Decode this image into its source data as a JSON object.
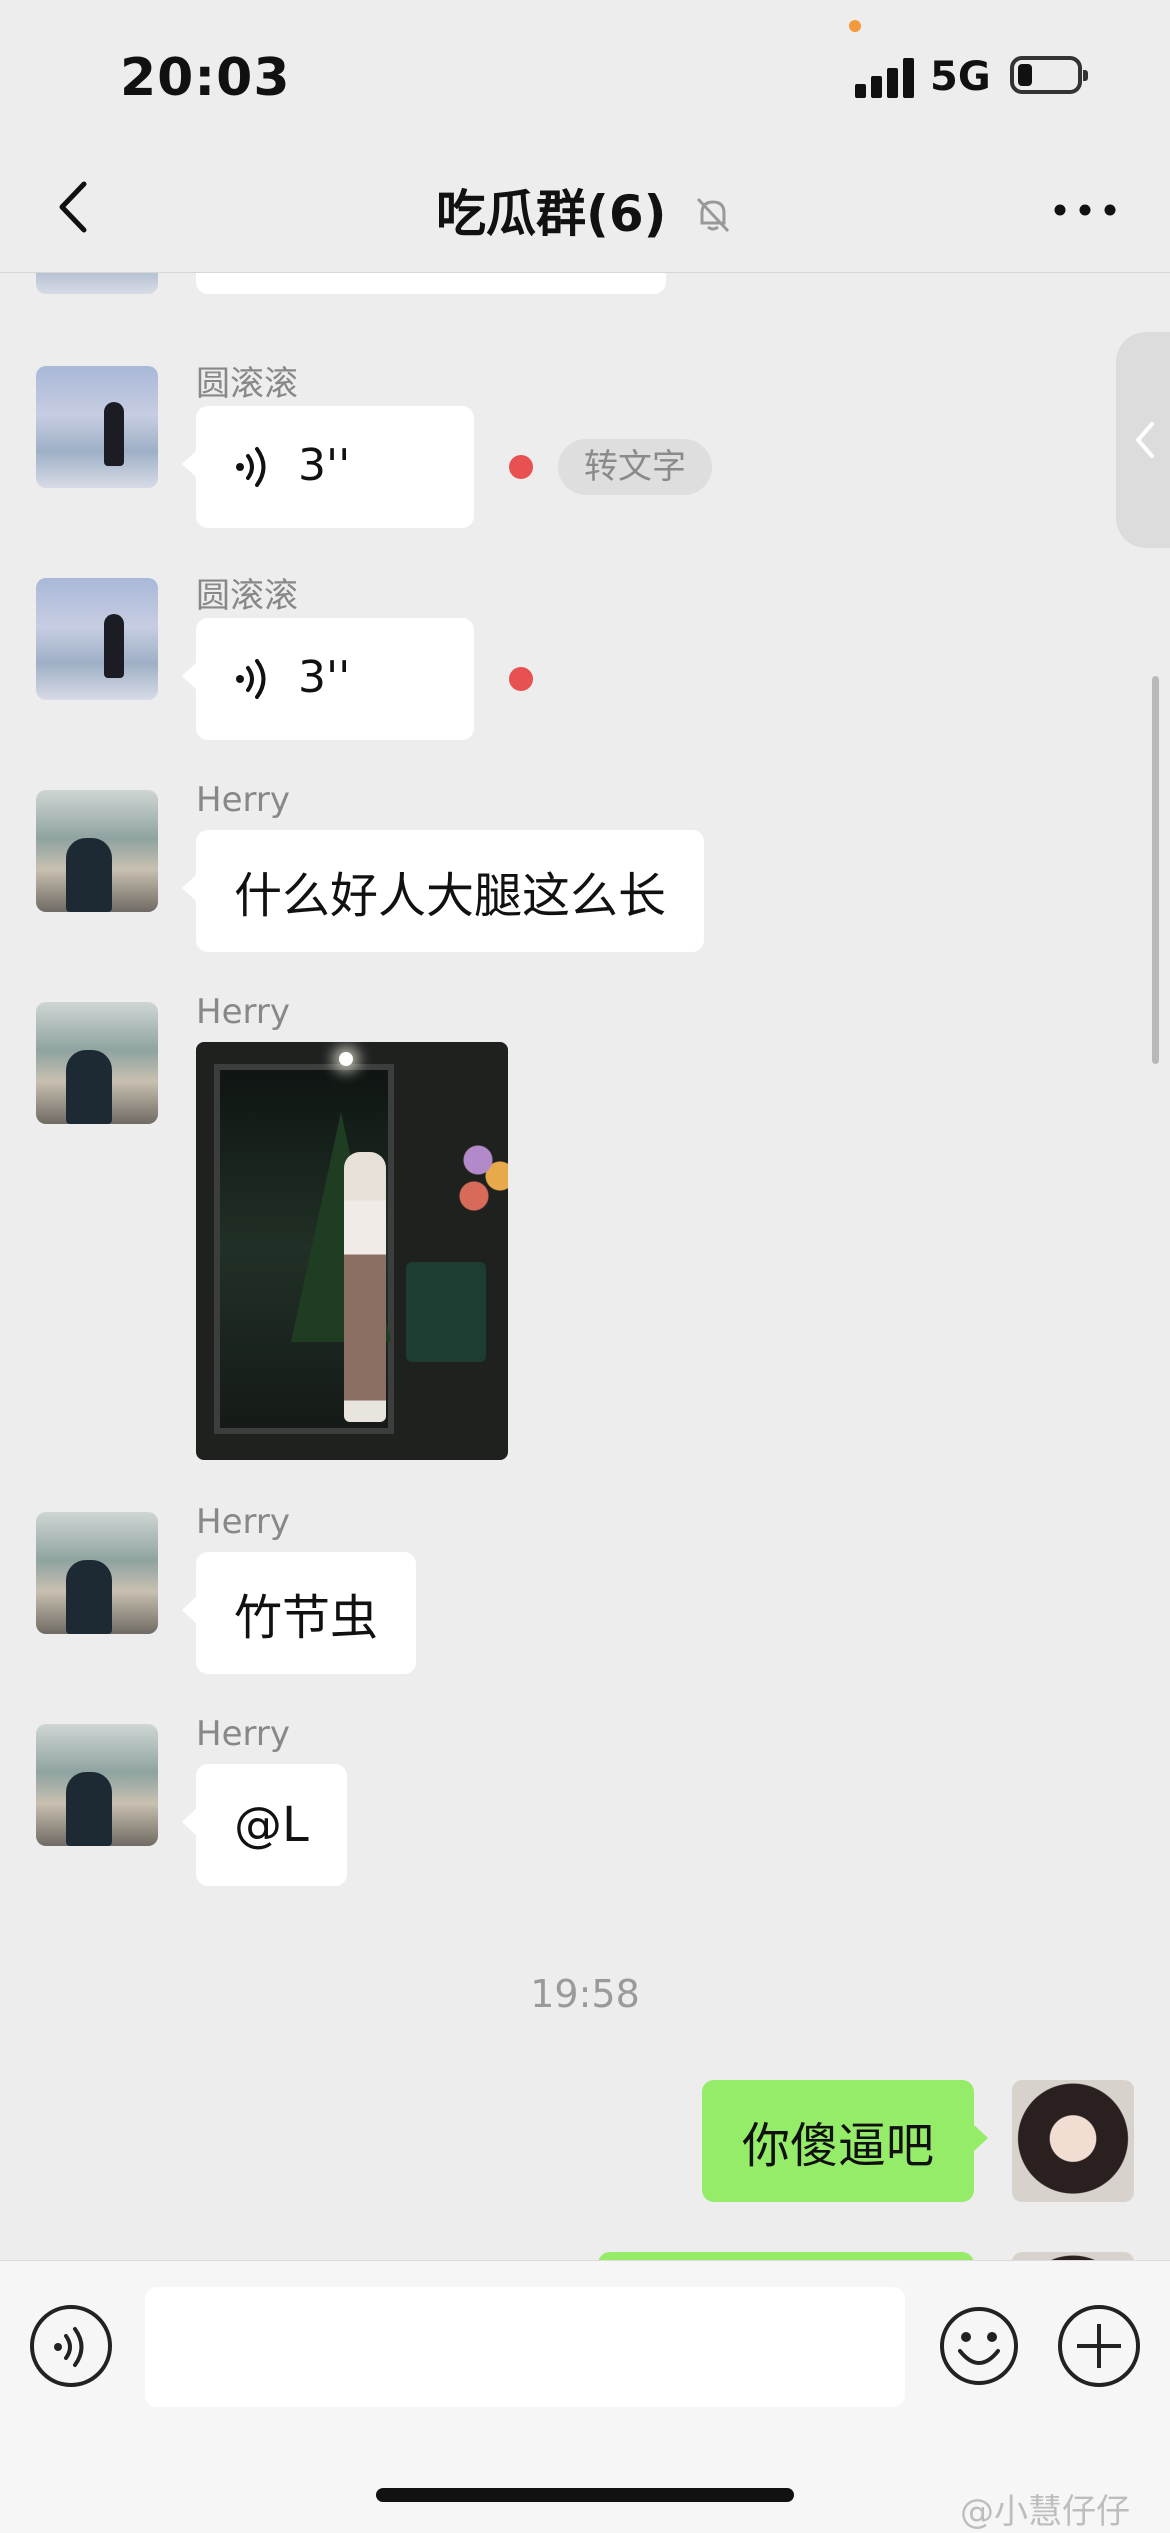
{
  "status_bar": {
    "time": "20:03",
    "network": "5G"
  },
  "nav": {
    "title": "吃瓜群(6)",
    "back_icon": "chevron-left-icon",
    "mute_icon": "bell-off-icon",
    "more_icon": "more-dots-icon"
  },
  "messages": [
    {
      "sender": "圆滚滚",
      "type": "voice",
      "duration": "3''",
      "unread": true,
      "action": "转文字"
    },
    {
      "sender": "圆滚滚",
      "type": "voice",
      "duration": "3''",
      "unread": true
    },
    {
      "sender": "Herry",
      "type": "text",
      "text": "什么好人大腿这么长"
    },
    {
      "sender": "Herry",
      "type": "image"
    },
    {
      "sender": "Herry",
      "type": "text",
      "text": "竹节虫"
    },
    {
      "sender": "Herry",
      "type": "text",
      "text": "@L"
    }
  ],
  "timestamp": "19:58",
  "my_messages": [
    {
      "text": "你傻逼吧"
    }
  ],
  "input": {
    "value": "",
    "placeholder": ""
  },
  "watermark": "@小慧仔仔",
  "colors": {
    "background": "#ededed",
    "my_bubble": "#95ec69",
    "unread_dot": "#e85152"
  }
}
